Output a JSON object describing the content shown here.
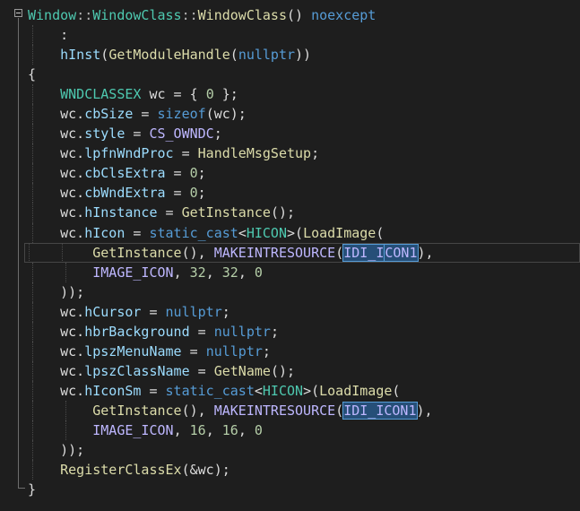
{
  "editor": {
    "lines": [
      {
        "segments": [
          {
            "cls": "t-type",
            "text": "Window"
          },
          {
            "cls": "t-op",
            "text": "::"
          },
          {
            "cls": "t-type",
            "text": "WindowClass"
          },
          {
            "cls": "t-op",
            "text": "::"
          },
          {
            "cls": "t-fn",
            "text": "WindowClass"
          },
          {
            "cls": "t-txt",
            "text": "() "
          },
          {
            "cls": "t-kw",
            "text": "noexcept"
          }
        ]
      },
      {
        "indent": 1,
        "segments": [
          {
            "cls": "t-txt",
            "text": "    :"
          }
        ]
      },
      {
        "indent": 1,
        "segments": [
          {
            "cls": "t-txt",
            "text": "    "
          },
          {
            "cls": "t-mem",
            "text": "hInst"
          },
          {
            "cls": "t-txt",
            "text": "("
          },
          {
            "cls": "t-fn",
            "text": "GetModuleHandle"
          },
          {
            "cls": "t-txt",
            "text": "("
          },
          {
            "cls": "t-kw",
            "text": "nullptr"
          },
          {
            "cls": "t-txt",
            "text": "))"
          }
        ]
      },
      {
        "segments": [
          {
            "cls": "t-txt",
            "text": "{"
          }
        ]
      },
      {
        "indent": 1,
        "segments": [
          {
            "cls": "t-txt",
            "text": "    "
          },
          {
            "cls": "t-type",
            "text": "WNDCLASSEX"
          },
          {
            "cls": "t-txt",
            "text": " wc = { "
          },
          {
            "cls": "t-num",
            "text": "0"
          },
          {
            "cls": "t-txt",
            "text": " };"
          }
        ]
      },
      {
        "indent": 1,
        "segments": [
          {
            "cls": "t-txt",
            "text": "    wc."
          },
          {
            "cls": "t-mem",
            "text": "cbSize"
          },
          {
            "cls": "t-txt",
            "text": " = "
          },
          {
            "cls": "t-kw",
            "text": "sizeof"
          },
          {
            "cls": "t-txt",
            "text": "(wc);"
          }
        ]
      },
      {
        "indent": 1,
        "segments": [
          {
            "cls": "t-txt",
            "text": "    wc."
          },
          {
            "cls": "t-mem",
            "text": "style"
          },
          {
            "cls": "t-txt",
            "text": " = "
          },
          {
            "cls": "t-macro",
            "text": "CS_OWNDC"
          },
          {
            "cls": "t-txt",
            "text": ";"
          }
        ]
      },
      {
        "indent": 1,
        "segments": [
          {
            "cls": "t-txt",
            "text": "    wc."
          },
          {
            "cls": "t-mem",
            "text": "lpfnWndProc"
          },
          {
            "cls": "t-txt",
            "text": " = "
          },
          {
            "cls": "t-fn",
            "text": "HandleMsgSetup"
          },
          {
            "cls": "t-txt",
            "text": ";"
          }
        ]
      },
      {
        "indent": 1,
        "segments": [
          {
            "cls": "t-txt",
            "text": "    wc."
          },
          {
            "cls": "t-mem",
            "text": "cbClsExtra"
          },
          {
            "cls": "t-txt",
            "text": " = "
          },
          {
            "cls": "t-num",
            "text": "0"
          },
          {
            "cls": "t-txt",
            "text": ";"
          }
        ]
      },
      {
        "indent": 1,
        "segments": [
          {
            "cls": "t-txt",
            "text": "    wc."
          },
          {
            "cls": "t-mem",
            "text": "cbWndExtra"
          },
          {
            "cls": "t-txt",
            "text": " = "
          },
          {
            "cls": "t-num",
            "text": "0"
          },
          {
            "cls": "t-txt",
            "text": ";"
          }
        ]
      },
      {
        "indent": 1,
        "segments": [
          {
            "cls": "t-txt",
            "text": "    wc."
          },
          {
            "cls": "t-mem",
            "text": "hInstance"
          },
          {
            "cls": "t-txt",
            "text": " = "
          },
          {
            "cls": "t-fn",
            "text": "GetInstance"
          },
          {
            "cls": "t-txt",
            "text": "();"
          }
        ]
      },
      {
        "indent": 1,
        "segments": [
          {
            "cls": "t-txt",
            "text": "    wc."
          },
          {
            "cls": "t-mem",
            "text": "hIcon"
          },
          {
            "cls": "t-txt",
            "text": " = "
          },
          {
            "cls": "t-kw",
            "text": "static_cast"
          },
          {
            "cls": "t-txt",
            "text": "<"
          },
          {
            "cls": "t-type",
            "text": "HICON"
          },
          {
            "cls": "t-txt",
            "text": ">("
          },
          {
            "cls": "t-fn",
            "text": "LoadImage"
          },
          {
            "cls": "t-txt",
            "text": "("
          }
        ]
      },
      {
        "indent": 2,
        "current": true,
        "segments": [
          {
            "cls": "t-txt",
            "text": "        "
          },
          {
            "cls": "t-fn",
            "text": "GetInstance"
          },
          {
            "cls": "t-txt",
            "text": "(), "
          },
          {
            "cls": "t-macro",
            "text": "MAKEINTRESOURCE"
          },
          {
            "cls": "t-txt",
            "text": "("
          },
          {
            "cls": "t-sel",
            "text": "IDI_I"
          },
          {
            "cls": "caret",
            "text": ""
          },
          {
            "cls": "t-sel",
            "text": "CON1"
          },
          {
            "cls": "t-txt",
            "text": "),"
          }
        ]
      },
      {
        "indent": 2,
        "segments": [
          {
            "cls": "t-txt",
            "text": "        "
          },
          {
            "cls": "t-macro",
            "text": "IMAGE_ICON"
          },
          {
            "cls": "t-txt",
            "text": ", "
          },
          {
            "cls": "t-num",
            "text": "32"
          },
          {
            "cls": "t-txt",
            "text": ", "
          },
          {
            "cls": "t-num",
            "text": "32"
          },
          {
            "cls": "t-txt",
            "text": ", "
          },
          {
            "cls": "t-num",
            "text": "0"
          }
        ]
      },
      {
        "indent": 1,
        "segments": [
          {
            "cls": "t-txt",
            "text": "    ));"
          }
        ]
      },
      {
        "indent": 1,
        "segments": [
          {
            "cls": "t-txt",
            "text": "    wc."
          },
          {
            "cls": "t-mem",
            "text": "hCursor"
          },
          {
            "cls": "t-txt",
            "text": " = "
          },
          {
            "cls": "t-kw",
            "text": "nullptr"
          },
          {
            "cls": "t-txt",
            "text": ";"
          }
        ]
      },
      {
        "indent": 1,
        "segments": [
          {
            "cls": "t-txt",
            "text": "    wc."
          },
          {
            "cls": "t-mem",
            "text": "hbrBackground"
          },
          {
            "cls": "t-txt",
            "text": " = "
          },
          {
            "cls": "t-kw",
            "text": "nullptr"
          },
          {
            "cls": "t-txt",
            "text": ";"
          }
        ]
      },
      {
        "indent": 1,
        "segments": [
          {
            "cls": "t-txt",
            "text": "    wc."
          },
          {
            "cls": "t-mem",
            "text": "lpszMenuName"
          },
          {
            "cls": "t-txt",
            "text": " = "
          },
          {
            "cls": "t-kw",
            "text": "nullptr"
          },
          {
            "cls": "t-txt",
            "text": ";"
          }
        ]
      },
      {
        "indent": 1,
        "segments": [
          {
            "cls": "t-txt",
            "text": "    wc."
          },
          {
            "cls": "t-mem",
            "text": "lpszClassName"
          },
          {
            "cls": "t-txt",
            "text": " = "
          },
          {
            "cls": "t-fn",
            "text": "GetName"
          },
          {
            "cls": "t-txt",
            "text": "();"
          }
        ]
      },
      {
        "indent": 1,
        "segments": [
          {
            "cls": "t-txt",
            "text": "    wc."
          },
          {
            "cls": "t-mem",
            "text": "hIconSm"
          },
          {
            "cls": "t-txt",
            "text": " = "
          },
          {
            "cls": "t-kw",
            "text": "static_cast"
          },
          {
            "cls": "t-txt",
            "text": "<"
          },
          {
            "cls": "t-type",
            "text": "HICON"
          },
          {
            "cls": "t-txt",
            "text": ">("
          },
          {
            "cls": "t-fn",
            "text": "LoadImage"
          },
          {
            "cls": "t-txt",
            "text": "("
          }
        ]
      },
      {
        "indent": 2,
        "segments": [
          {
            "cls": "t-txt",
            "text": "        "
          },
          {
            "cls": "t-fn",
            "text": "GetInstance"
          },
          {
            "cls": "t-txt",
            "text": "(), "
          },
          {
            "cls": "t-macro",
            "text": "MAKEINTRESOURCE"
          },
          {
            "cls": "t-txt",
            "text": "("
          },
          {
            "cls": "t-sel",
            "text": "IDI_ICON1"
          },
          {
            "cls": "t-txt",
            "text": "),"
          }
        ]
      },
      {
        "indent": 2,
        "segments": [
          {
            "cls": "t-txt",
            "text": "        "
          },
          {
            "cls": "t-macro",
            "text": "IMAGE_ICON"
          },
          {
            "cls": "t-txt",
            "text": ", "
          },
          {
            "cls": "t-num",
            "text": "16"
          },
          {
            "cls": "t-txt",
            "text": ", "
          },
          {
            "cls": "t-num",
            "text": "16"
          },
          {
            "cls": "t-txt",
            "text": ", "
          },
          {
            "cls": "t-num",
            "text": "0"
          }
        ]
      },
      {
        "indent": 1,
        "segments": [
          {
            "cls": "t-txt",
            "text": "    ));"
          }
        ]
      },
      {
        "indent": 1,
        "segments": [
          {
            "cls": "t-txt",
            "text": "    "
          },
          {
            "cls": "t-fn",
            "text": "RegisterClassEx"
          },
          {
            "cls": "t-txt",
            "text": "(&wc);"
          }
        ]
      },
      {
        "segments": [
          {
            "cls": "t-txt",
            "text": "}"
          }
        ]
      }
    ]
  }
}
